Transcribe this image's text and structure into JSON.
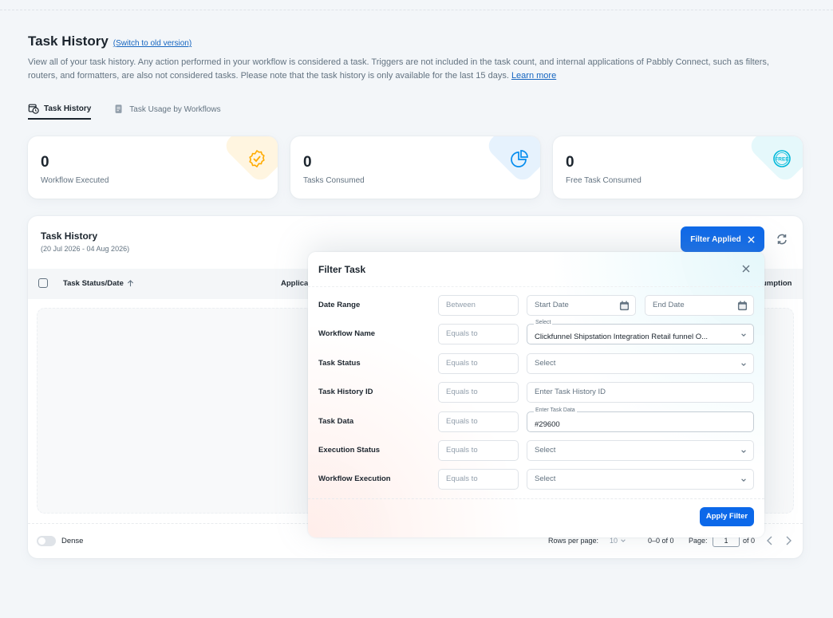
{
  "page": {
    "title": "Task History",
    "old_version_link": "(Switch to old version)",
    "description": "View all of your task history. Any action performed in your workflow is considered a task. Triggers are not included in the task count, and internal applications of Pabbly Connect, such as filters, routers, and formatters, are also not considered tasks. Please note that the task history is only available for the last 15 days.",
    "learn_more": "Learn more"
  },
  "tabs": [
    {
      "label": "Task History",
      "icon": "calendar-clock-icon",
      "active": true
    },
    {
      "label": "Task Usage by Workflows",
      "icon": "document-icon",
      "active": false
    }
  ],
  "stats": [
    {
      "value": "0",
      "label": "Workflow Executed",
      "icon": "badge-check-icon",
      "color": "#ffab00"
    },
    {
      "value": "0",
      "label": "Tasks Consumed",
      "icon": "pie-chart-icon",
      "color": "#078dee"
    },
    {
      "value": "0",
      "label": "Free Task Consumed",
      "icon": "free-badge-icon",
      "color": "#00b8d9"
    }
  ],
  "table": {
    "title": "Task History",
    "date_range": "(20 Jul 2026 - 04 Aug 2026)",
    "filter_button": "Filter Applied",
    "columns": [
      "Task Status/Date",
      "Applica",
      "umption"
    ],
    "dense_label": "Dense",
    "rows_per_page_label": "Rows per page:",
    "rows_per_page_value": "10",
    "range_text": "0–0 of 0",
    "page_label": "Page:",
    "page_value": "1",
    "of_pages": "of 0"
  },
  "filter_modal": {
    "title": "Filter Task",
    "apply_button": "Apply Filter",
    "rows": [
      {
        "label": "Date Range",
        "operator": "Between",
        "start_placeholder": "Start Date",
        "end_placeholder": "End Date"
      },
      {
        "label": "Workflow Name",
        "operator": "Equals to",
        "float_label": "Select",
        "value": "Clickfunnel Shipstation Integration Retail funnel O..."
      },
      {
        "label": "Task Status",
        "operator": "Equals to",
        "value": "Select"
      },
      {
        "label": "Task History ID",
        "operator": "Equals to",
        "placeholder": "Enter Task History ID"
      },
      {
        "label": "Task Data",
        "operator": "Equals to",
        "float_label": "Enter Task Data",
        "value": "#29600"
      },
      {
        "label": "Execution Status",
        "operator": "Equals to",
        "value": "Select"
      },
      {
        "label": "Workflow Execution",
        "operator": "Equals to",
        "value": "Select"
      }
    ]
  }
}
